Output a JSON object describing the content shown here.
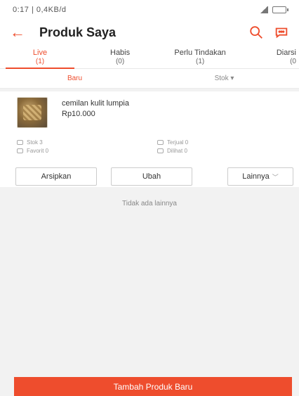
{
  "status_bar": {
    "left_text": "0:17 | 0,4KB/d",
    "battery_icon": "battery-icon",
    "signal_icon": "signal-icon"
  },
  "header": {
    "title": "Produk Saya",
    "back_icon": "arrow-left-icon",
    "search_icon": "search-icon",
    "chat_icon": "chat-icon"
  },
  "tabs": [
    {
      "label": "Live",
      "count": "(1)"
    },
    {
      "label": "Habis",
      "count": "(0)"
    },
    {
      "label": "Perlu Tindakan",
      "count": "(1)"
    },
    {
      "label": "Diarsi",
      "count": "(0"
    }
  ],
  "subfilter": {
    "left": "Baru",
    "right": "Stok ▾"
  },
  "product": {
    "name": "cemilan kulit lumpia",
    "price": "Rp10.000",
    "stats": {
      "stok": "Stok 3",
      "favorit": "Favorit 0",
      "terjual": "Terjual 0",
      "dilihat": "Dilihat 0"
    },
    "actions": {
      "archive": "Arsipkan",
      "edit": "Ubah",
      "more": "Lainnya"
    }
  },
  "empty_note": "Tidak ada lainnya",
  "footer": {
    "add_button": "Tambah Produk Baru"
  },
  "colors": {
    "accent": "#ee4d2d"
  }
}
